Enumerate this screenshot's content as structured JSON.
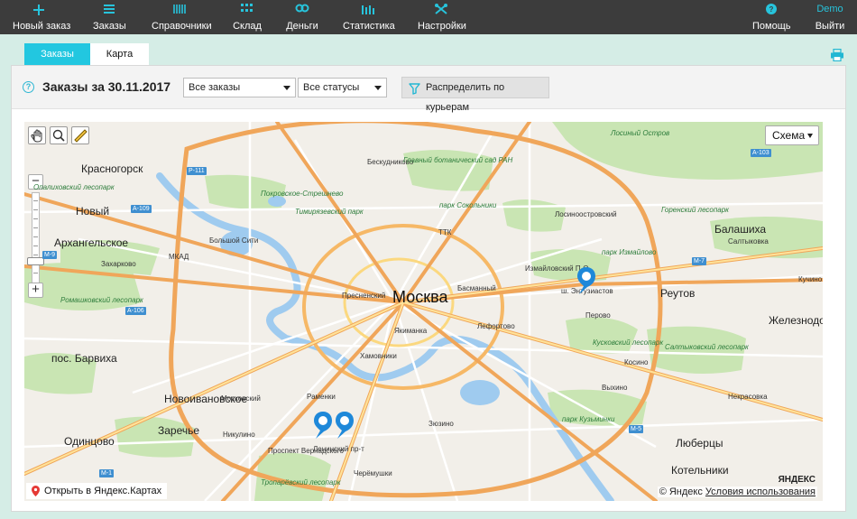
{
  "header": {
    "nav": [
      {
        "label": "Новый заказ",
        "icon": "plus-icon"
      },
      {
        "label": "Заказы",
        "icon": "list-icon"
      },
      {
        "label": "Справочники",
        "icon": "books-icon"
      },
      {
        "label": "Склад",
        "icon": "grid-icon"
      },
      {
        "label": "Деньги",
        "icon": "coins-icon"
      },
      {
        "label": "Статистика",
        "icon": "bars-icon"
      },
      {
        "label": "Настройки",
        "icon": "tools-icon"
      }
    ],
    "help_label": "Помощь",
    "user_name": "Demo",
    "logout_label": "Выйти"
  },
  "tabs": {
    "orders": "Заказы",
    "map": "Карта"
  },
  "toolbar": {
    "title": "Заказы за 30.11.2017",
    "orders_filter": "Все заказы",
    "status_filter": "Все статусы",
    "distribute_label": "Распределить по курьерам"
  },
  "map": {
    "scheme_label": "Схема",
    "open_label": "Открыть в Яндекс.Картах",
    "copyright": "© Яндекс",
    "terms_label": "Условия использования",
    "logo_text": "ЯНДЕКС",
    "labels": {
      "moscow": "Москва",
      "krasnogorsk": "Красногорск",
      "balashikha": "Балашиха",
      "reutov": "Реутов",
      "zheleznodor": "Железнодор",
      "odintsovo": "Одинцово",
      "novoivankovskoe": "Новоивановское",
      "lyubertsy": "Люберцы",
      "kotelniki": "Котельники",
      "arkhangelskoe": "Архангельское",
      "zarechye": "Заречье",
      "barvikha": "пос. Барвиха",
      "perovo": "Перово",
      "izmaylovo": "Измайловский П-О",
      "novy": "Новый",
      "zakharkovo": "Захарково",
      "bolshoy_gorod": "Большой Сити",
      "mkad": "МКАД",
      "ttk": "ТТК",
      "sokolniki": "парк Сокольники",
      "losiny": "Лосиный Остров",
      "kuskovsky": "Кусковский лесопарк",
      "saltykovsky": "Салтыковский лесопарк",
      "kuzminki": "парк Кузьминки",
      "troparevsky": "Тропарёвский лесопарк",
      "gorensky": "Горенский лесопарк",
      "saltykovka": "Салтыковка",
      "kuchino": "Кучино",
      "opalikhovsky": "Опалиховский лесопарк",
      "romashkovsky": "Ромашковский лесопарк",
      "botanic": "Главный ботанический сад РАН",
      "lefortovo": "Лефортово",
      "yakimanka": "Якиманка",
      "ramenki": "Раменки",
      "khamovniki": "Хамовники",
      "presnensky": "Пресненский",
      "basmanny": "Басманный",
      "mitino_rd": "Ленинский пр-т",
      "ent": "ш. Энтузиастов",
      "izmaylovsky_park": "парк Измайлово",
      "strelka": "Московский",
      "nikulino": "Никулино",
      "vernadsky": "Проспект Вернадского",
      "cheremushki": "Черёмушки",
      "zyuzino": "Зюзино",
      "khimki": "Покровское-Стрешнево",
      "timiryazev": "Тимирязевский парк",
      "beskudnikovo": "Бескудниково",
      "losinoostrovsky": "Лосиноостровский",
      "kosino": "Косино",
      "vykhino": "Выхино",
      "nekrasovka": "Некрасовка",
      "a106": "А-106",
      "a109": "А-109",
      "m9": "М-9",
      "r111": "Р-111",
      "m7": "М-7",
      "a103": "А-103",
      "m5": "М-5",
      "m1": "М-1"
    }
  }
}
